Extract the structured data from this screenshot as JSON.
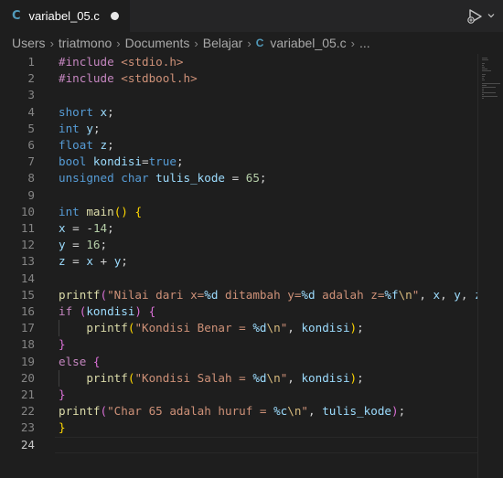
{
  "tab": {
    "icon": "C",
    "title": "variabel_05.c"
  },
  "breadcrumb": {
    "items": [
      "Users",
      "triatmono",
      "Documents",
      "Belajar"
    ],
    "file_icon": "C",
    "file": "variabel_05.c",
    "more": "..."
  },
  "icons": {
    "run": "run-debug-icon",
    "dropdown": "chevron-down-icon",
    "unsaved": "unsaved-dot-icon"
  },
  "editor": {
    "active_line": 24,
    "lines": [
      {
        "n": "1"
      },
      {
        "n": "2"
      },
      {
        "n": "3"
      },
      {
        "n": "4"
      },
      {
        "n": "5"
      },
      {
        "n": "6"
      },
      {
        "n": "7"
      },
      {
        "n": "8"
      },
      {
        "n": "9"
      },
      {
        "n": "10"
      },
      {
        "n": "11"
      },
      {
        "n": "12"
      },
      {
        "n": "13"
      },
      {
        "n": "14"
      },
      {
        "n": "15"
      },
      {
        "n": "16"
      },
      {
        "n": "17"
      },
      {
        "n": "18"
      },
      {
        "n": "19"
      },
      {
        "n": "20"
      },
      {
        "n": "21"
      },
      {
        "n": "22"
      },
      {
        "n": "23"
      },
      {
        "n": "24"
      }
    ],
    "code": [
      [
        [
          "pp",
          "#include "
        ],
        [
          "inc",
          "<stdio.h>"
        ]
      ],
      [
        [
          "pp",
          "#include "
        ],
        [
          "inc",
          "<stdbool.h>"
        ]
      ],
      [],
      [
        [
          "kw",
          "short "
        ],
        [
          "id",
          "x"
        ],
        [
          "plain",
          ";"
        ]
      ],
      [
        [
          "kw",
          "int "
        ],
        [
          "id",
          "y"
        ],
        [
          "plain",
          ";"
        ]
      ],
      [
        [
          "kw",
          "float "
        ],
        [
          "id",
          "z"
        ],
        [
          "plain",
          ";"
        ]
      ],
      [
        [
          "kw",
          "bool "
        ],
        [
          "id",
          "kondisi"
        ],
        [
          "plain",
          "="
        ],
        [
          "kw",
          "true"
        ],
        [
          "plain",
          ";"
        ]
      ],
      [
        [
          "kw",
          "unsigned char "
        ],
        [
          "id",
          "tulis_kode"
        ],
        [
          "plain",
          " = "
        ],
        [
          "num",
          "65"
        ],
        [
          "plain",
          ";"
        ]
      ],
      [],
      [
        [
          "kw",
          "int "
        ],
        [
          "fn",
          "main"
        ],
        [
          "br1",
          "()"
        ],
        [
          "plain",
          " "
        ],
        [
          "br1",
          "{"
        ]
      ],
      [
        [
          "id",
          "x"
        ],
        [
          "plain",
          " = "
        ],
        [
          "plain",
          "-"
        ],
        [
          "num",
          "14"
        ],
        [
          "plain",
          ";"
        ]
      ],
      [
        [
          "id",
          "y"
        ],
        [
          "plain",
          " = "
        ],
        [
          "num",
          "16"
        ],
        [
          "plain",
          ";"
        ]
      ],
      [
        [
          "id",
          "z"
        ],
        [
          "plain",
          " = "
        ],
        [
          "id",
          "x"
        ],
        [
          "plain",
          " + "
        ],
        [
          "id",
          "y"
        ],
        [
          "plain",
          ";"
        ]
      ],
      [],
      [
        [
          "fn",
          "printf"
        ],
        [
          "br2",
          "("
        ],
        [
          "str",
          "\"Nilai dari x="
        ],
        [
          "fmt",
          "%d"
        ],
        [
          "str",
          " ditambah y="
        ],
        [
          "fmt",
          "%d"
        ],
        [
          "str",
          " adalah z="
        ],
        [
          "fmt",
          "%f"
        ],
        [
          "esc",
          "\\n"
        ],
        [
          "str",
          "\""
        ],
        [
          "plain",
          ", "
        ],
        [
          "id",
          "x"
        ],
        [
          "plain",
          ", "
        ],
        [
          "id",
          "y"
        ],
        [
          "plain",
          ", "
        ],
        [
          "id",
          "z"
        ],
        [
          "br2",
          ")"
        ]
      ],
      [
        [
          "ctl",
          "if "
        ],
        [
          "br2",
          "("
        ],
        [
          "id",
          "kondisi"
        ],
        [
          "br2",
          ")"
        ],
        [
          "plain",
          " "
        ],
        [
          "br2",
          "{"
        ]
      ],
      [
        [
          "plain",
          "    "
        ],
        [
          "fn",
          "printf"
        ],
        [
          "br1",
          "("
        ],
        [
          "str",
          "\"Kondisi Benar = "
        ],
        [
          "fmt",
          "%d"
        ],
        [
          "esc",
          "\\n"
        ],
        [
          "str",
          "\""
        ],
        [
          "plain",
          ", "
        ],
        [
          "id",
          "kondisi"
        ],
        [
          "br1",
          ")"
        ],
        [
          "plain",
          ";"
        ]
      ],
      [
        [
          "br2",
          "}"
        ]
      ],
      [
        [
          "ctl",
          "else "
        ],
        [
          "br2",
          "{"
        ]
      ],
      [
        [
          "plain",
          "    "
        ],
        [
          "fn",
          "printf"
        ],
        [
          "br1",
          "("
        ],
        [
          "str",
          "\"Kondisi Salah = "
        ],
        [
          "fmt",
          "%d"
        ],
        [
          "esc",
          "\\n"
        ],
        [
          "str",
          "\""
        ],
        [
          "plain",
          ", "
        ],
        [
          "id",
          "kondisi"
        ],
        [
          "br1",
          ")"
        ],
        [
          "plain",
          ";"
        ]
      ],
      [
        [
          "br2",
          "}"
        ]
      ],
      [
        [
          "fn",
          "printf"
        ],
        [
          "br2",
          "("
        ],
        [
          "str",
          "\"Char 65 adalah huruf = "
        ],
        [
          "fmt",
          "%c"
        ],
        [
          "esc",
          "\\n"
        ],
        [
          "str",
          "\""
        ],
        [
          "plain",
          ", "
        ],
        [
          "id",
          "tulis_kode"
        ],
        [
          "br2",
          ")"
        ],
        [
          "plain",
          ";"
        ]
      ],
      [
        [
          "br1",
          "}"
        ]
      ],
      []
    ]
  }
}
